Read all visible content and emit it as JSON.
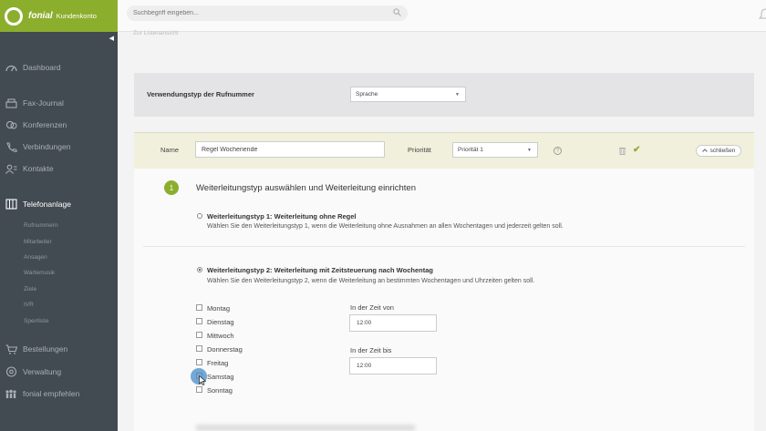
{
  "brand": {
    "name": "fonial",
    "sub": "Kundenkonto"
  },
  "search": {
    "placeholder": "Suchbegriff eingeben..."
  },
  "back_link": "Zur Listenansicht",
  "nav": {
    "items": [
      {
        "label": "Dashboard",
        "icon": "speedometer-icon"
      },
      {
        "label": "Fax-Journal",
        "icon": "fax-icon"
      },
      {
        "label": "Konferenzen",
        "icon": "conference-icon"
      },
      {
        "label": "Verbindungen",
        "icon": "phone-icon"
      },
      {
        "label": "Kontakte",
        "icon": "contacts-icon"
      },
      {
        "label": "Telefonanlage",
        "icon": "pbx-icon"
      },
      {
        "label": "Bestellungen",
        "icon": "cart-icon"
      },
      {
        "label": "Verwaltung",
        "icon": "settings-icon"
      },
      {
        "label": "fonial empfehlen",
        "icon": "people-icon"
      }
    ],
    "sub_items": [
      "Rufnummern",
      "Mitarbeiter",
      "Ansagen",
      "Wartemusik",
      "Ziele",
      "IVR",
      "Sperrliste"
    ]
  },
  "usage": {
    "label": "Verwendungstyp der Rufnummer",
    "value": "Sprache"
  },
  "rule": {
    "name_label": "Name",
    "name_value": "Regel Wochenende",
    "priority_label": "Priorität",
    "priority_value": "Priorität 1",
    "help": "?",
    "close_label": "schließen"
  },
  "step": {
    "number": "1",
    "title": "Weiterleitungstyp auswählen und Weiterleitung einrichten",
    "option1": {
      "title": "Weiterleitungstyp 1: Weiterleitung ohne Regel",
      "desc": "Wählen Sie den Weiterleitungstyp 1, wenn die Weiterleitung ohne Ausnahmen an allen Wochentagen und jederzeit gelten soll."
    },
    "option2": {
      "title": "Weiterleitungstyp 2: Weiterleitung mit Zeitsteuerung nach Wochentag",
      "desc": "Wählen Sie den Weiterleitungstyp 2, wenn die Weiterleitung an bestimmten Wochentagen und Uhrzeiten gelten soll."
    },
    "days": [
      "Montag",
      "Dienstag",
      "Mittwoch",
      "Donnerstag",
      "Freitag",
      "Samstag",
      "Sonntag"
    ],
    "from_label": "In der Zeit von",
    "from_value": "12:00",
    "to_label": "In der Zeit bis",
    "to_value": "12:00"
  },
  "colors": {
    "accent": "#8cae2d",
    "sidebar": "#424a52",
    "rule_band": "#f1f0dc"
  }
}
